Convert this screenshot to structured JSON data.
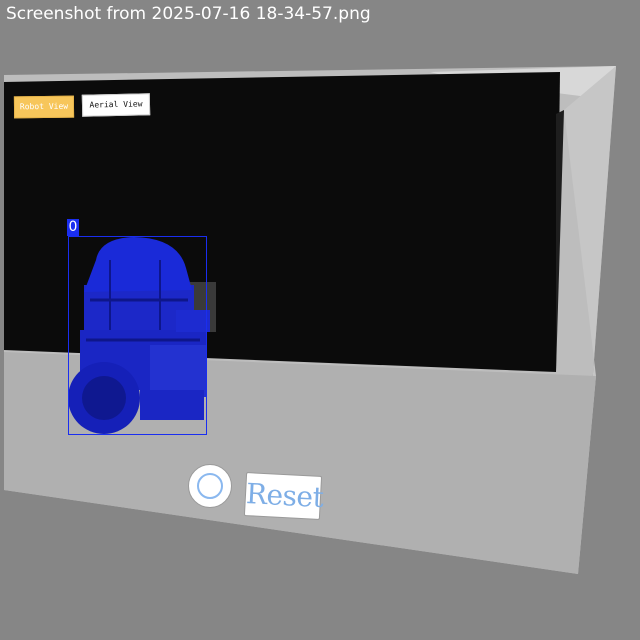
{
  "window": {
    "filename": "Screenshot from 2025-07-16 18-34-57.png"
  },
  "viewer": {
    "buttons": {
      "robot_view": "Robot View",
      "aerial_view": "Aerial View"
    },
    "detection": {
      "label": "0",
      "color": "#1a2ef0"
    },
    "controls": {
      "record_icon": "circle-record-icon",
      "reset_label": "Reset"
    }
  },
  "colors": {
    "background": "#868686",
    "screen": "#0b0b0b",
    "floor": "#b0b0b0",
    "robot_view_button": "#f7c65b",
    "accent_blue": "#7eaee6"
  }
}
